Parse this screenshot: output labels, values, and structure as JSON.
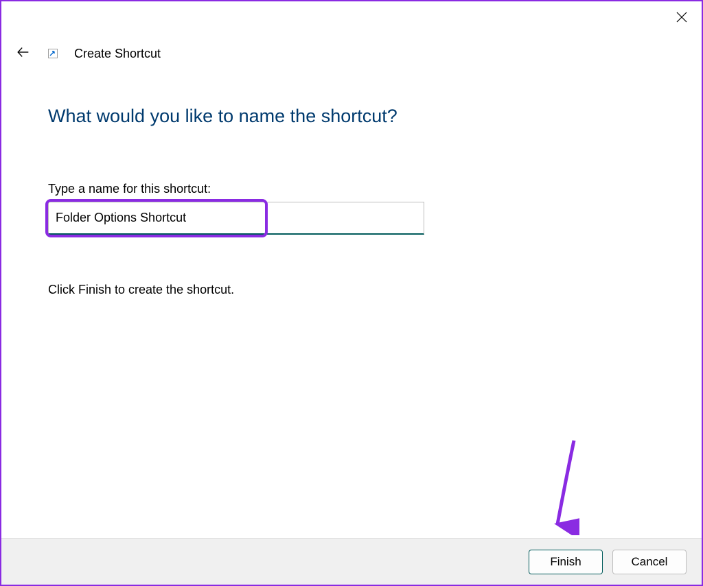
{
  "window": {
    "title": "Create Shortcut"
  },
  "content": {
    "question": "What would you like to name the shortcut?",
    "input_label": "Type a name for this shortcut:",
    "input_value": "Folder Options Shortcut",
    "instruction": "Click Finish to create the shortcut."
  },
  "buttons": {
    "finish": "Finish",
    "cancel": "Cancel"
  },
  "colors": {
    "accent_border": "#8a2be2",
    "heading": "#003a6e",
    "input_underline": "#005a5a"
  }
}
